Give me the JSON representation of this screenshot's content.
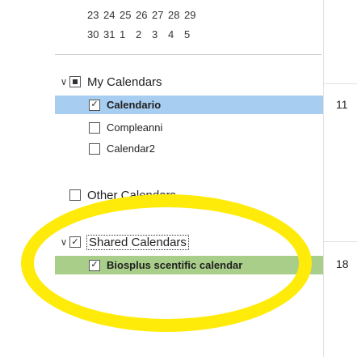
{
  "mini_calendar": {
    "weeks": [
      [
        "23",
        "24",
        "25",
        "26",
        "27",
        "28",
        "29"
      ],
      [
        "30",
        "31",
        "1",
        "2",
        "3",
        "4",
        "5"
      ]
    ]
  },
  "groups": {
    "my_calendars": {
      "label": "My Calendars",
      "items": [
        {
          "label": "Calendario",
          "checked": true,
          "selected": true
        },
        {
          "label": "Compleanni",
          "checked": false
        },
        {
          "label": "Calendar2",
          "checked": false
        }
      ]
    },
    "other_calendars": {
      "label": "Other Calendars"
    },
    "shared_calendars": {
      "label": "Shared Calendars",
      "items": [
        {
          "label": "Biosplus scentific calendar",
          "checked": true,
          "selected": true
        }
      ]
    }
  },
  "right_column": {
    "numbers": [
      "11",
      "18"
    ]
  },
  "colors": {
    "selected_blue": "#a7cdf0",
    "selected_green": "#a9ce8a",
    "highlight": "#ffeb0a"
  }
}
